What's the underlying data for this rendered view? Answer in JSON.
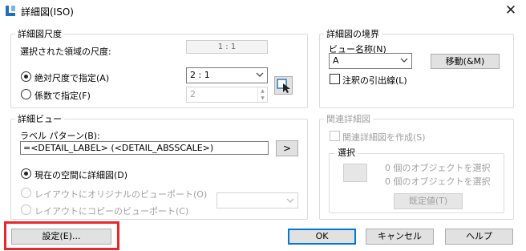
{
  "window": {
    "title": "詳細図(ISO)",
    "close_glyph": "✕"
  },
  "scale_group": {
    "label": "詳細図尺度",
    "selected_area_label": "選択された領域の尺度:",
    "selected_area_value": "1 : 1",
    "absolute_radio_label": "絶対尺度で指定(A)",
    "absolute_combo_value": "2 : 1",
    "factor_radio_label": "係数で指定(F)",
    "factor_spin_value": "2"
  },
  "boundary_group": {
    "label": "詳細図の境界",
    "view_name_label": "ビュー名称(N)",
    "view_name_value": "A",
    "move_button": "移動(&M)",
    "leader_checkbox_label": "注釈の引出線(L)"
  },
  "detail_view_group": {
    "label": "詳細ビュー",
    "label_pattern_label": "ラベル パターン(B):",
    "label_pattern_value": "=<DETAIL_LABEL> (<DETAIL_ABSSCALE>)",
    "insert_button": ">",
    "current_space_radio": "現在の空間に詳細図(D)",
    "layout_original_radio": "レイアウトにオリジナルのビューポート(O)",
    "layout_copy_radio": "レイアウトにコピーのビューポート(C)"
  },
  "related_group": {
    "label": "関連詳細図",
    "create_checkbox_label": "関連詳細図を作成(S)",
    "selection_label": "選択",
    "count_line_1": "0 個のオブジェクトを選択",
    "count_line_2": "0 個のオブジェクトを選択",
    "default_button": "既定値(T)"
  },
  "footer": {
    "settings_button": "設定(E)...",
    "ok_button": "OK",
    "cancel_button": "キャンセル",
    "help_button": "ヘルプ"
  },
  "colors": {
    "highlight": "#e8262b",
    "primary_border": "#0078d7",
    "app_icon": "#1f6fbf"
  }
}
